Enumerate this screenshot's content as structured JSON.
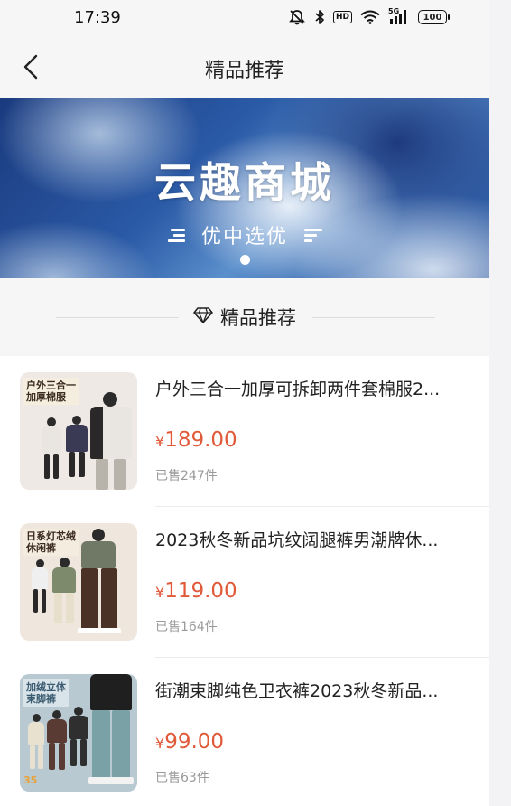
{
  "status_bar": {
    "time": "17:39",
    "icons": [
      "mute-icon",
      "bluetooth-icon",
      "hd-icon",
      "wifi-icon",
      "signal-5g-icon",
      "battery-icon"
    ],
    "hd_label": "HD",
    "network_label": "5G",
    "battery_level": "100"
  },
  "nav": {
    "title": "精品推荐",
    "back_icon": "chevron-left-icon"
  },
  "banner": {
    "title": "云趣商城",
    "subtitle": "优中选优",
    "slide_count": 1,
    "active_slide": 1
  },
  "section": {
    "title": "精品推荐",
    "icon": "diamond-icon"
  },
  "products": [
    {
      "title": "户外三合一加厚可拆卸两件套棉服2...",
      "currency": "¥",
      "price": "189.00",
      "sold": "已售247件",
      "thumb_label": "户外三合一\n加厚棉服",
      "thumb_colors": {
        "bg": "#efe9e6",
        "tag_bg": "#f5eede",
        "tag_fg": "#3a2a20",
        "body1": "#e9e6e1",
        "body2": "#2a2828",
        "body3": "#3b3a55"
      }
    },
    {
      "title": "2023秋冬新品坑纹阔腿裤男潮牌休...",
      "currency": "¥",
      "price": "119.00",
      "sold": "已售164件",
      "thumb_label": "日系灯芯绒\n休闲裤",
      "thumb_colors": {
        "bg": "#efe7dd",
        "tag_bg": "#f4ecdf",
        "tag_fg": "#3a2a20",
        "body1": "#7d8b6c",
        "body2": "#4a3326",
        "body3": "#e7dfcc"
      }
    },
    {
      "title": "街潮束脚纯色卫衣裤2023秋冬新品...",
      "currency": "¥",
      "price": "99.00",
      "sold": "已售63件",
      "thumb_label": "加绒立体\n束脚裤",
      "thumb_price": "35",
      "thumb_colors": {
        "bg": "#b9c9d2",
        "tag_bg": "#d9e4ea",
        "tag_fg": "#3b5b70",
        "body1": "#e9e1cf",
        "body2": "#5a3b34",
        "body3": "#7aa2a6"
      }
    }
  ]
}
